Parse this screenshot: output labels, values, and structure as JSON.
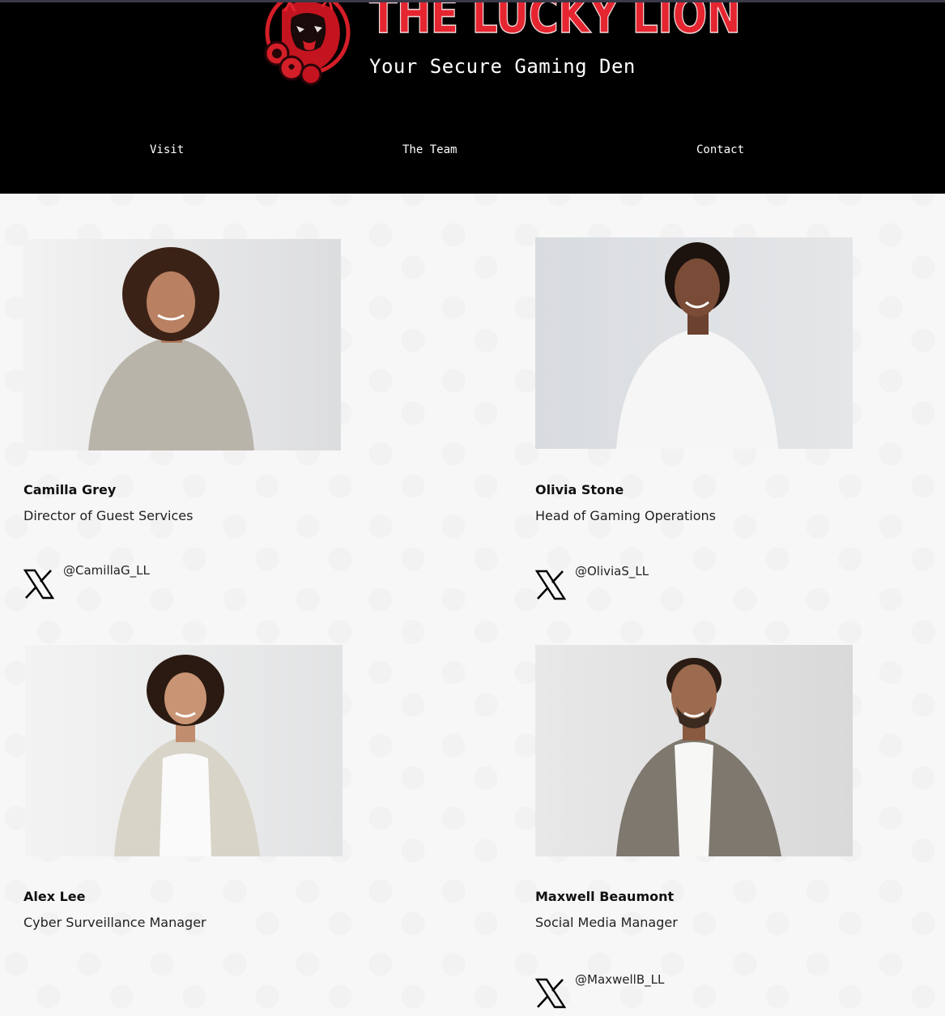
{
  "brand": {
    "name": "THE LUCKY LION",
    "tagline": "Your Secure Gaming Den"
  },
  "nav": {
    "items": [
      {
        "label": "Visit"
      },
      {
        "label": "The Team"
      },
      {
        "label": "Contact"
      }
    ]
  },
  "team": [
    {
      "name": "Camilla Grey",
      "role": "Director of Guest Services",
      "handle": "@CamillaG_LL",
      "icon": "x-logo-icon"
    },
    {
      "name": "Olivia Stone",
      "role": "Head of Gaming Operations",
      "handle": "@OliviaS_LL",
      "icon": "x-logo-icon"
    },
    {
      "name": "Alex Lee",
      "role": "Cyber Surveillance Manager",
      "handle": null,
      "icon": null
    },
    {
      "name": "Maxwell Beaumont",
      "role": "Social Media Manager",
      "handle": "@MaxwellB_LL",
      "icon": "x-logo-icon"
    }
  ],
  "colors": {
    "header_bg": "#000000",
    "brand_red": "#e52530",
    "page_bg": "#f7f7f7"
  }
}
